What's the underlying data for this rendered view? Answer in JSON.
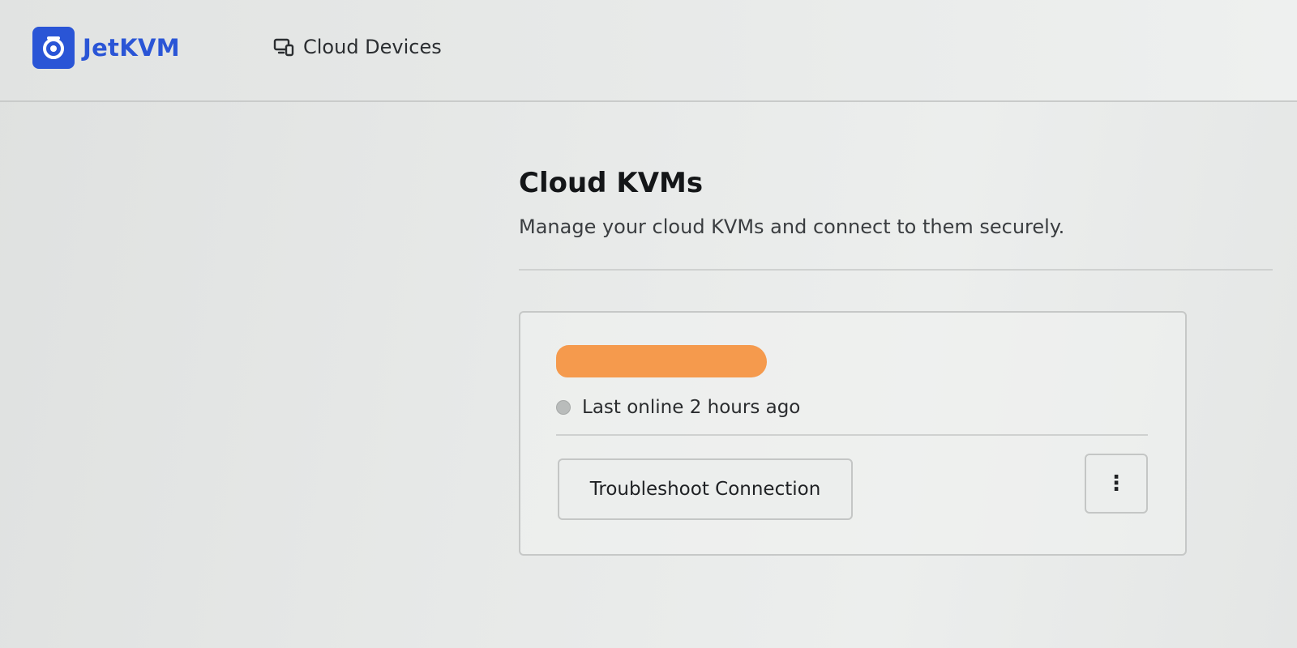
{
  "app": {
    "name": "JetKVM",
    "brand_color": "#2a55d6"
  },
  "nav": {
    "cloud_devices_label": "Cloud Devices",
    "cloud_devices_icon": "devices-icon"
  },
  "page": {
    "title": "Cloud KVMs",
    "subtitle": "Manage your cloud KVMs and connect to them securely."
  },
  "device": {
    "name": "",
    "name_redaction_color": "#f59a4d",
    "status_text": "Last online 2 hours ago",
    "status_color": "#b9bcbb",
    "troubleshoot_label": "Troubleshoot Connection",
    "more_label": "⋮",
    "more_icon": "more-vertical-icon"
  }
}
